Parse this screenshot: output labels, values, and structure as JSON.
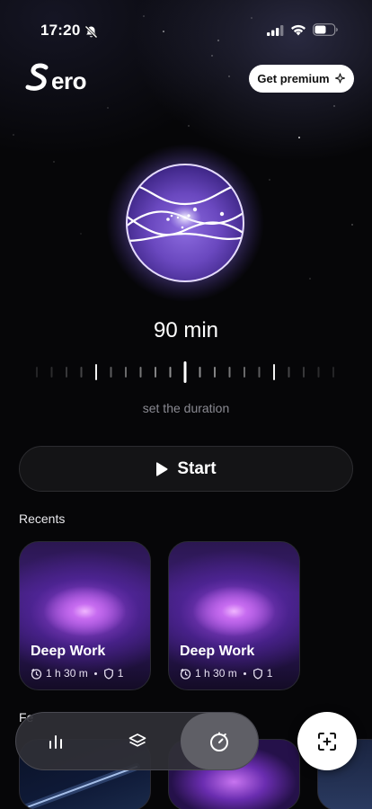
{
  "status_bar": {
    "time": "17:20"
  },
  "app": {
    "logo_text": "ero",
    "premium_label": "Get premium"
  },
  "timer": {
    "duration_label": "90 min",
    "duration_minutes": 90,
    "hint": "set the duration"
  },
  "start": {
    "label": "Start"
  },
  "recents": {
    "title": "Recents",
    "items": [
      {
        "title": "Deep Work",
        "duration": "1 h 30 m",
        "count": "1"
      },
      {
        "title": "Deep Work",
        "duration": "1 h 30 m",
        "count": "1"
      }
    ]
  },
  "second_section": {
    "title": "Fe"
  },
  "nav": {
    "items": [
      {
        "icon": "bar-chart-icon",
        "active": false
      },
      {
        "icon": "layers-icon",
        "active": false
      },
      {
        "icon": "timer-icon",
        "active": true
      }
    ],
    "scan_icon": "add-scan-icon"
  },
  "colors": {
    "accent_purple": "#9b5cf0",
    "orb_glow": "#b79cff",
    "background": "#060608"
  }
}
